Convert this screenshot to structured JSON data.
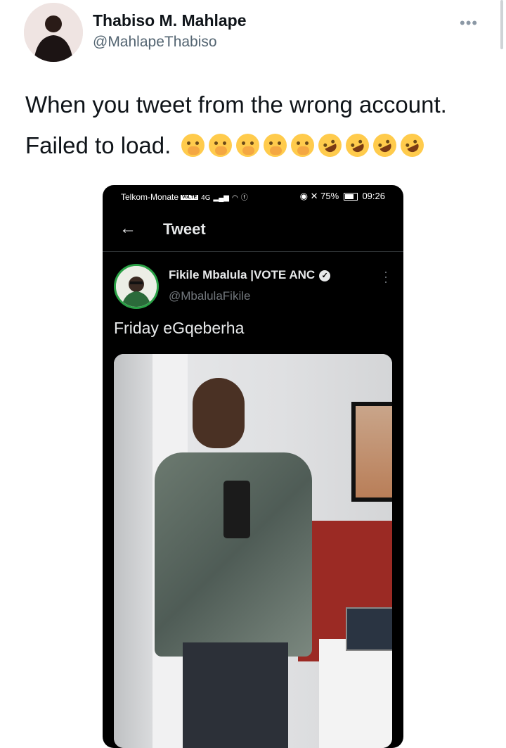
{
  "tweet": {
    "author_name": "Thabiso M. Mahlape",
    "author_handle": "@MahlapeThabiso",
    "more_label": "•••",
    "line1": "When you tweet from the wrong account.",
    "line2": "Failed to load.",
    "emojis": [
      "face-with-hand-over-mouth",
      "face-with-hand-over-mouth",
      "face-with-hand-over-mouth",
      "face-with-hand-over-mouth",
      "face-with-hand-over-mouth",
      "rolling-on-floor-laughing",
      "rolling-on-floor-laughing",
      "rolling-on-floor-laughing",
      "rolling-on-floor-laughing"
    ]
  },
  "embedded_screenshot": {
    "status_bar": {
      "carrier": "Telkom-Monate",
      "volte": "VoLTE",
      "network": "4G",
      "battery": "75%",
      "time": "09:26"
    },
    "header": {
      "back_icon": "arrow-left-icon",
      "title": "Tweet"
    },
    "post": {
      "author_name": "Fikile Mbalula |VOTE ANC",
      "verified_icon": "verified-check-icon",
      "author_handle": "@MbalulaFikile",
      "text": "Friday eGqeberha",
      "more_label": "⋮"
    }
  },
  "colors": {
    "accent_black": "#000000",
    "text_primary": "#0f1419",
    "text_secondary": "#536471"
  }
}
